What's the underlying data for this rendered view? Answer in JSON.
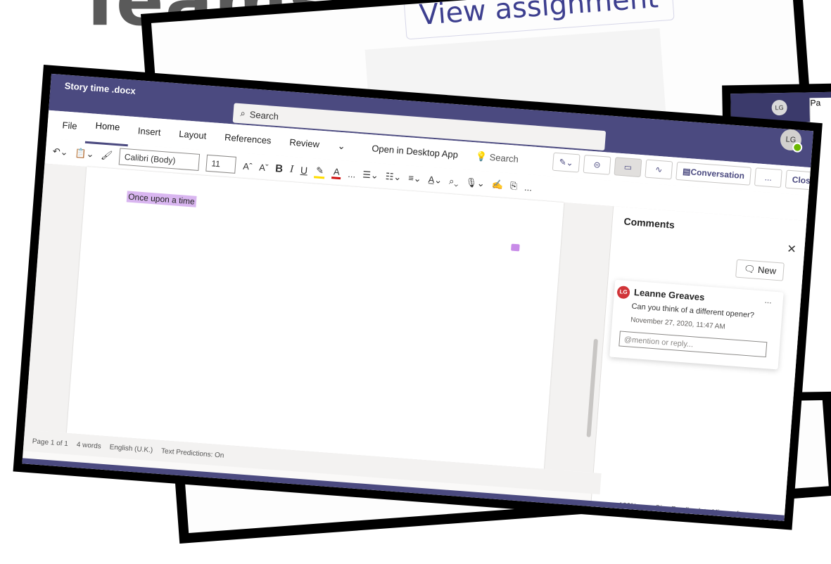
{
  "background": {
    "app_title": "Teams",
    "view_assignment": "View assignment",
    "right_strip": {
      "avatar": "LG",
      "paste_label": "Pa",
      "more": "...",
      "comment_icon": "comment-icon"
    }
  },
  "word": {
    "doc_title": "Story time .docx",
    "search_placeholder": "Search",
    "tabs": [
      "File",
      "Home",
      "Insert",
      "Layout",
      "References",
      "Review"
    ],
    "active_tab": "Home",
    "open_desktop": "Open in Desktop App",
    "tell_me": "Search",
    "conversation": "Conversation",
    "close": "Close",
    "more": "...",
    "avatar": "LG",
    "font_name": "Calibri (Body)",
    "font_size": "11",
    "bold": "B",
    "italic": "I",
    "underline": "U",
    "highlight_letter": "✎",
    "font_color_letter": "A",
    "grow_font": "Aˆ",
    "shrink_font": "Aˇ",
    "ribbon_more": "...",
    "ribbon_more_right": "...",
    "document_text": "Once upon a time",
    "comments": {
      "title": "Comments",
      "new_label": "New",
      "items": [
        {
          "initials": "LG",
          "author": "Leanne Greaves",
          "text": "Can you think of a different opener?",
          "date": "November 27, 2020, 11:47 AM",
          "reply_placeholder": "@mention or reply..."
        }
      ]
    },
    "status": {
      "page": "Page 1 of 1",
      "words": "4 words",
      "language": "English (U.K.)",
      "predictions": "Text Predictions: On"
    },
    "zoom": {
      "minus": "—",
      "level": "100%",
      "plus": "+",
      "feedback": "Give Feedback to Microsoft"
    }
  },
  "colors": {
    "title_bar": "#4b4a80",
    "highlight": "#ffdd00",
    "font_color": "#d01010",
    "comment_highlight": "#d9b6f0",
    "avatar_red": "#d13438",
    "presence_green": "#6bb700"
  }
}
